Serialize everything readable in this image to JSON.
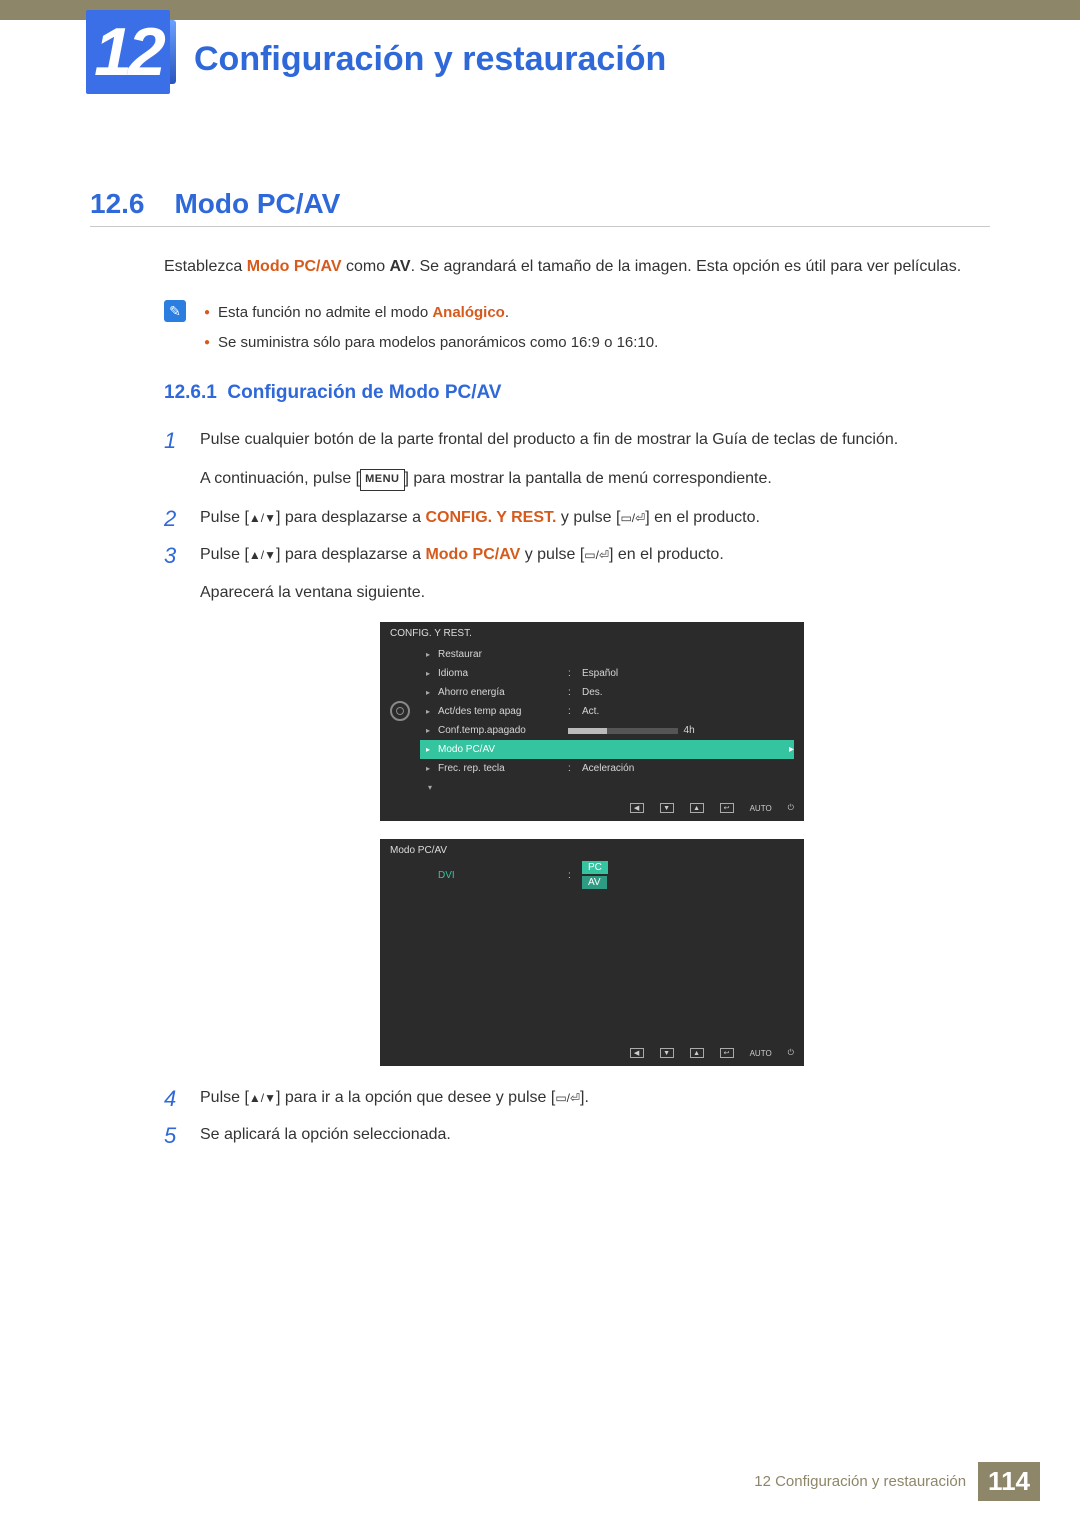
{
  "chapter": {
    "number": "12",
    "title": "Configuración y restauración"
  },
  "section": {
    "number": "12.6",
    "title": "Modo PC/AV"
  },
  "intro": {
    "prefix": "Establezca ",
    "term1": "Modo PC/AV",
    "mid": " como ",
    "term2": "AV",
    "suffix": ". Se agrandará el tamaño de la imagen. Esta opción es útil para ver películas."
  },
  "notes": {
    "item1_prefix": "Esta función no admite el modo ",
    "item1_term": "Analógico",
    "item1_suffix": ".",
    "item2": "Se suministra sólo para modelos panorámicos como 16:9 o 16:10."
  },
  "subsection": {
    "number": "12.6.1",
    "title": "Configuración de Modo PC/AV"
  },
  "steps": {
    "s1_a": "Pulse cualquier botón de la parte frontal del producto a fin de mostrar la Guía de teclas de función.",
    "s1_b_prefix": "A continuación, pulse [",
    "s1_b_menu": "MENU",
    "s1_b_suffix": "] para mostrar la pantalla de menú correspondiente.",
    "s2_prefix": "Pulse [",
    "s2_mid": "] para desplazarse a ",
    "s2_term": "CONFIG. Y REST.",
    "s2_mid2": " y pulse [",
    "s2_suffix": "] en el producto.",
    "s3_prefix": "Pulse [",
    "s3_mid": "] para desplazarse a ",
    "s3_term": "Modo PC/AV",
    "s3_mid2": " y pulse [",
    "s3_suffix": "] en el producto.",
    "s3_after": "Aparecerá la ventana siguiente.",
    "s4_prefix": "Pulse [",
    "s4_mid": "] para ir a la opción que desee y pulse [",
    "s4_suffix": "].",
    "s5": "Se aplicará la opción seleccionada."
  },
  "osd1": {
    "title": "CONFIG. Y REST.",
    "rows": [
      {
        "label": "Restaurar",
        "val": ""
      },
      {
        "label": "Idioma",
        "val": "Español"
      },
      {
        "label": "Ahorro energía",
        "val": "Des."
      },
      {
        "label": "Act/des temp apag",
        "val": "Act."
      },
      {
        "label": "Conf.temp.apagado",
        "val": "",
        "slider": 35,
        "right": "4h"
      },
      {
        "label": "Modo PC/AV",
        "val": "",
        "selected": true
      },
      {
        "label": "Frec. rep. tecla",
        "val": "Aceleración"
      }
    ],
    "footer": [
      "◀",
      "▼",
      "▲",
      "↩",
      "AUTO",
      "⏻"
    ]
  },
  "osd2": {
    "title": "Modo PC/AV",
    "left_label": "DVI",
    "opts": [
      "PC",
      "AV"
    ],
    "footer": [
      "◀",
      "▼",
      "▲",
      "↩",
      "AUTO",
      "⏻"
    ]
  },
  "footer": {
    "text": "12 Configuración y restauración",
    "page": "114"
  }
}
